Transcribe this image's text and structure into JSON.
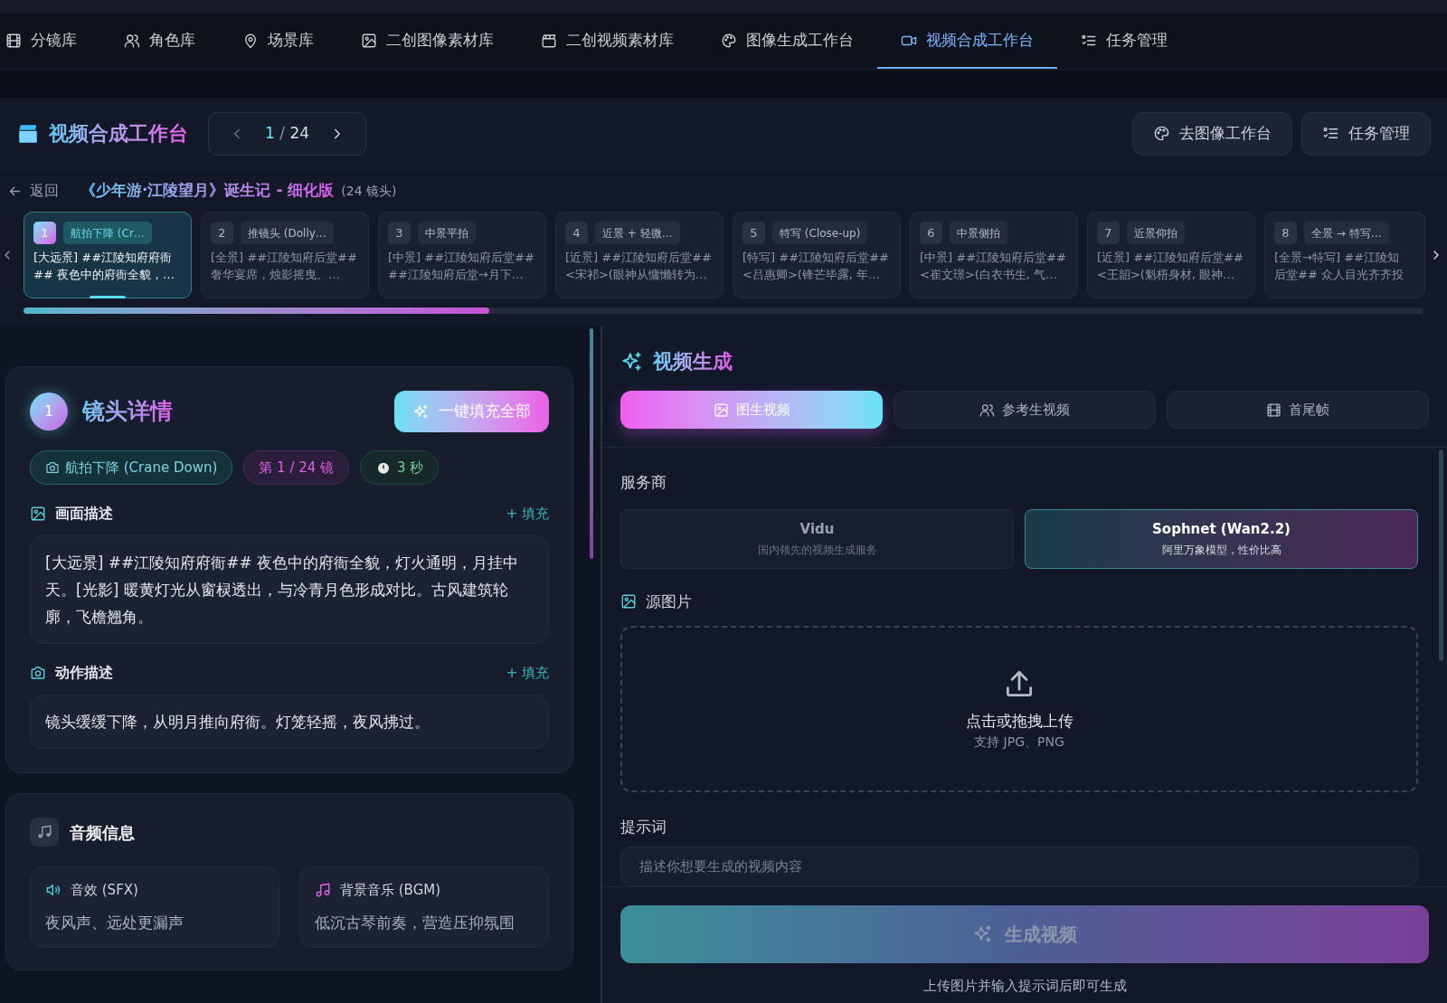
{
  "nav_tabs": [
    {
      "kind": "film",
      "label": "分镜库",
      "selected": false
    },
    {
      "kind": "users",
      "label": "角色库",
      "selected": false
    },
    {
      "kind": "pin",
      "label": "场景库",
      "selected": false
    },
    {
      "kind": "image",
      "label": "二创图像素材库",
      "selected": false
    },
    {
      "kind": "clapper",
      "label": "二创视频素材库",
      "selected": false
    },
    {
      "kind": "palette",
      "label": "图像生成工作台",
      "selected": false
    },
    {
      "kind": "video",
      "label": "视频合成工作台",
      "selected": true
    },
    {
      "kind": "list",
      "label": "任务管理",
      "selected": false
    }
  ],
  "header": {
    "title": "视频合成工作台",
    "pager": {
      "current": "1",
      "separator": "/",
      "total": "24"
    },
    "buttons": [
      {
        "kind": "palette",
        "label": "去图像工作台"
      },
      {
        "kind": "list",
        "label": "任务管理"
      }
    ]
  },
  "breadcrumb": {
    "back": "返回",
    "project": "《少年游·江陵望月》诞生记 - 细化版",
    "count": "(24 镜头)"
  },
  "shots": [
    {
      "number": "1",
      "tag": "航拍下降 (Cr…",
      "lines": [
        "[大远景] ##江陵知府府衙",
        "## 夜色中的府衙全貌，…"
      ],
      "selected": true
    },
    {
      "number": "2",
      "tag": "推镜头 (Dolly…",
      "lines": [
        "[全景] ##江陵知府后堂##",
        "奢华宴席，烛影摇曳。…"
      ],
      "selected": false
    },
    {
      "number": "3",
      "tag": "中景平拍",
      "lines": [
        "[中景] ##江陵知府后堂##",
        "##江陵知府后堂→月下…"
      ],
      "selected": false
    },
    {
      "number": "4",
      "tag": "近景 + 轻微…",
      "lines": [
        "[近景] ##江陵知府后堂##",
        "<宋祁>(眼神从慵懒转为…"
      ],
      "selected": false
    },
    {
      "number": "5",
      "tag": "特写 (Close-up)",
      "lines": [
        "[特写] ##江陵知府后堂##",
        "<吕惠卿>(锋芒毕露, 年…"
      ],
      "selected": false
    },
    {
      "number": "6",
      "tag": "中景侧拍",
      "lines": [
        "[中景] ##江陵知府后堂##",
        "<崔文璟>(白衣书生, 气…"
      ],
      "selected": false
    },
    {
      "number": "7",
      "tag": "近景仰拍",
      "lines": [
        "[近景] ##江陵知府后堂##",
        "<王韶>(魁梧身材, 眼神…"
      ],
      "selected": false
    },
    {
      "number": "8",
      "tag": "全景 → 特写…",
      "lines": [
        "[全景→特写] ##江陵知",
        "后堂## 众人目光齐齐投"
      ],
      "selected": false
    }
  ],
  "shot_progress": {
    "level": 0.333
  },
  "detail": {
    "number": "1",
    "title": "镜头详情",
    "fill_all": "一键填充全部",
    "chips": [
      {
        "kind": "camera",
        "text": "航拍下降 (Crane Down)"
      },
      {
        "kind": "index",
        "text": "第 1 / 24 镜"
      },
      {
        "kind": "duration",
        "text": "3 秒"
      }
    ],
    "sections": [
      {
        "kind": "image",
        "label": "画面描述",
        "fill": "+ 填充",
        "text": "[大远景] ##江陵知府府衙## 夜色中的府衙全貌，灯火通明，月挂中天。[光影] 暖黄灯光从窗棂透出，与冷青月色形成对比。古风建筑轮廓，飞檐翘角。"
      },
      {
        "kind": "camera",
        "label": "动作描述",
        "fill": "+ 填充",
        "text": "镜头缓缓下降，从明月推向府衙。灯笼轻摇，夜风拂过。"
      }
    ]
  },
  "audio": {
    "title": "音频信息",
    "items": [
      {
        "kind": "sfx",
        "label": "音效 (SFX)",
        "text": "夜风声、远处更漏声"
      },
      {
        "kind": "bgm",
        "label": "背景音乐 (BGM)",
        "text": "低沉古琴前奏，营造压抑氛围"
      }
    ]
  },
  "video": {
    "title": "视频生成",
    "modes": [
      {
        "kind": "image",
        "label": "图生视频",
        "selected": true
      },
      {
        "kind": "users",
        "label": "参考生视频",
        "selected": false
      },
      {
        "kind": "film",
        "label": "首尾帧",
        "selected": false
      }
    ],
    "provider_label": "服务商",
    "providers": [
      {
        "name": "Vidu",
        "description": "国内领先的视频生成服务",
        "selected": false
      },
      {
        "name": "Sophnet (Wan2.2)",
        "description": "阿里万象模型，性价比高",
        "selected": true
      }
    ],
    "source_label": "源图片",
    "upload": {
      "title": "点击或拖拽上传",
      "hint": "支持 JPG、PNG"
    },
    "prompt_label": "提示词",
    "prompt_placeholder": "描述你想要生成的视频内容",
    "generate": "生成视频",
    "footer_hint": "上传图片并输入提示词后即可生成"
  }
}
